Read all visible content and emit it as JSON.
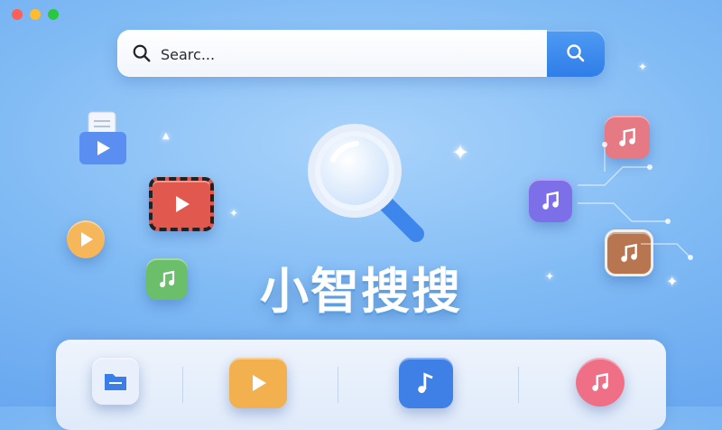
{
  "window": {
    "controls": [
      "close",
      "minimize",
      "maximize"
    ]
  },
  "search": {
    "placeholder": "Searc..."
  },
  "hero": {
    "title": "小智搜搜"
  },
  "decorations": {
    "icons": [
      "document-video-icon",
      "video-player-icon",
      "play-circle-icon",
      "music-note-icon",
      "music-note-icon",
      "music-note-icon",
      "music-note-icon"
    ]
  },
  "bottom_bar": {
    "items": [
      {
        "icon": "folder-icon"
      },
      {
        "icon": "play-icon"
      },
      {
        "icon": "music-note-icon"
      },
      {
        "icon": "music-note-icon"
      }
    ]
  },
  "colors": {
    "accent": "#2f7de8",
    "background": "#7fbaf4",
    "red": "#fe5f57",
    "yellow": "#febc2e",
    "green": "#28c840"
  }
}
